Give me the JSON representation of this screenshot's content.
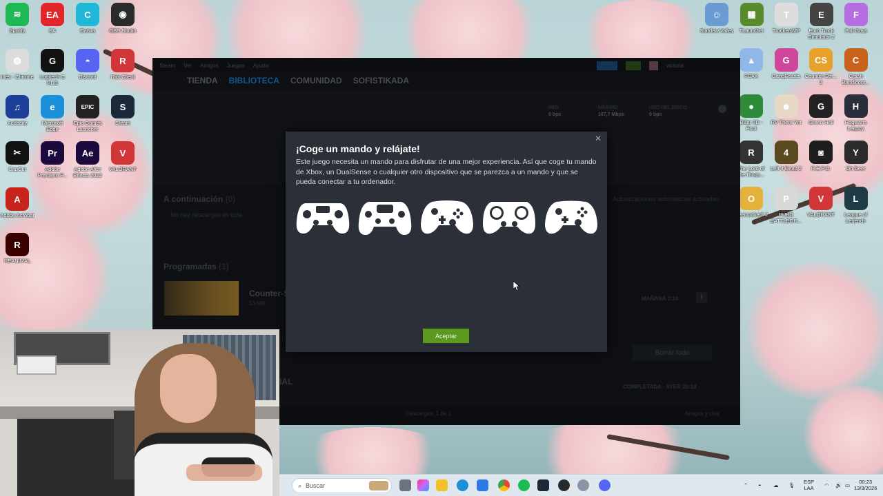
{
  "desktop_left": [
    {
      "label": "Spotify",
      "color": "#1db954",
      "glyph": "≋"
    },
    {
      "label": "EA",
      "color": "#e3262b",
      "glyph": "EA"
    },
    {
      "label": "Canva",
      "color": "#21b8d8",
      "glyph": "C"
    },
    {
      "label": "OBS Studio",
      "color": "#2a2a2a",
      "glyph": "◉"
    },
    {
      "label": "Inés - Chrome",
      "color": "#dcdcdc",
      "glyph": "◍"
    },
    {
      "label": "Logitech G HUB",
      "color": "#111111",
      "glyph": "G"
    },
    {
      "label": "Discord",
      "color": "#5865f2",
      "glyph": "◓"
    },
    {
      "label": "Riot Client",
      "color": "#d13639",
      "glyph": "R"
    },
    {
      "label": "Audacity",
      "color": "#1d3f97",
      "glyph": "♫"
    },
    {
      "label": "Microsoft Edge",
      "color": "#1b8fd8",
      "glyph": "e"
    },
    {
      "label": "Epic Games Launcher",
      "color": "#222222",
      "glyph": "EPIC"
    },
    {
      "label": "Steam",
      "color": "#1b2838",
      "glyph": "S"
    },
    {
      "label": "CapCut",
      "color": "#111111",
      "glyph": "✂"
    },
    {
      "label": "Adobe Premiere P...",
      "color": "#1c0a3f",
      "glyph": "Pr"
    },
    {
      "label": "Adobe After Effects 2022",
      "color": "#1c0a3f",
      "glyph": "Ae"
    },
    {
      "label": "VALORANT",
      "color": "#d13639",
      "glyph": "V"
    },
    {
      "label": "Adobe Acrobat",
      "color": "#c8241c",
      "glyph": "A"
    },
    {
      "label": "REANIMAL",
      "color": "#3a0000",
      "glyph": "R"
    }
  ],
  "desktop_right": [
    {
      "label": "Stardew Valley",
      "color": "#6b9bd3",
      "glyph": "☺"
    },
    {
      "label": "TLauncher",
      "color": "#5a8a2e",
      "glyph": "▦"
    },
    {
      "label": "TruckersMP",
      "color": "#dddddd",
      "glyph": "T"
    },
    {
      "label": "Euro Truck Simulator 2",
      "color": "#444444",
      "glyph": "E"
    },
    {
      "label": "Fall Guys",
      "color": "#b46ee0",
      "glyph": "F"
    },
    {
      "label": "PEAK",
      "color": "#8fb8e8",
      "glyph": "▲"
    },
    {
      "label": "GangBeasts",
      "color": "#d0469c",
      "glyph": "G"
    },
    {
      "label": "Counter-Stri... 2",
      "color": "#e8a12c",
      "glyph": "CS"
    },
    {
      "label": "Crash Bandicoot...",
      "color": "#c8631e",
      "glyph": "C"
    },
    {
      "label": "Billar 3D - Pool",
      "color": "#2d8b3a",
      "glyph": "●"
    },
    {
      "label": "RV There Yet",
      "color": "#e7d7c4",
      "glyph": "☻"
    },
    {
      "label": "Green Hell",
      "color": "#222222",
      "glyph": "G"
    },
    {
      "label": "Hogwarts Legacy",
      "color": "#2a2e3a",
      "glyph": "H"
    },
    {
      "label": "The Lord of the Rings...",
      "color": "#333333",
      "glyph": "R"
    },
    {
      "label": "Left 4 Dead 2",
      "color": "#5a4b1e",
      "glyph": "4"
    },
    {
      "label": "R.E.P.O.",
      "color": "#1e1e1e",
      "glyph": "◙"
    },
    {
      "label": "Oh Deer",
      "color": "#2b2b2b",
      "glyph": "Y"
    },
    {
      "label": "Overcooked! 2",
      "color": "#e2b23a",
      "glyph": "O"
    },
    {
      "label": "PUBG BATTLEGR...",
      "color": "#d8d8d8",
      "glyph": "P"
    },
    {
      "label": "VALORANT",
      "color": "#d13639",
      "glyph": "V"
    },
    {
      "label": "League of Legends",
      "color": "#1f3b44",
      "glyph": "L"
    }
  ],
  "steam": {
    "title_menu": [
      "Steam",
      "Ver",
      "Amigos",
      "Juegos",
      "Ayuda"
    ],
    "user": "victoria",
    "nav": [
      "TIENDA",
      "BIBLIOTECA",
      "COMUNIDAD",
      "SOFISTIKADA"
    ],
    "stats": [
      {
        "label": "RED",
        "value": "0 bps"
      },
      {
        "label": "MÁXIMO",
        "value": "167,7 Mbps"
      },
      {
        "label": "USO DEL DISCO",
        "value": "0 bps"
      }
    ],
    "up_next": "A continuación",
    "up_next_count": "(0)",
    "no_downloads": "No hay descargas en cola",
    "auto_updates": "Actualizaciones automáticas activadas",
    "scheduled": "Programadas",
    "scheduled_count": "(1)",
    "game_name": "Counter-Strike 2",
    "game_size": "53 MB",
    "schedule_time": "MAÑANA 3:16",
    "clear_all": "Borrar todo",
    "completed_label": "IAL",
    "completed_meta": "COMPLETADA · AYER 20:18",
    "footer_downloads": "Descargas: 1 de 1",
    "footer_right": "Amigos y chat"
  },
  "dialog": {
    "title": "¡Coge un mando y relájate!",
    "body": "Este juego necesita un mando para disfrutar de una mejor experiencia. Así que coge tu mando de Xbox, un DualSense o cualquier otro dispositivo que se parezca a un mando y que se pueda conectar a tu ordenador.",
    "accept": "Aceptar",
    "close_icon": "close-icon",
    "controllers": [
      "playstation-controller-icon",
      "dualsense-controller-icon",
      "xbox-controller-icon",
      "steam-controller-icon",
      "switch-pro-controller-icon"
    ]
  },
  "taskbar": {
    "search_placeholder": "Buscar",
    "lang_1": "ESP",
    "lang_2": "LAA",
    "time": "00:23",
    "date": "13/3/2026"
  }
}
